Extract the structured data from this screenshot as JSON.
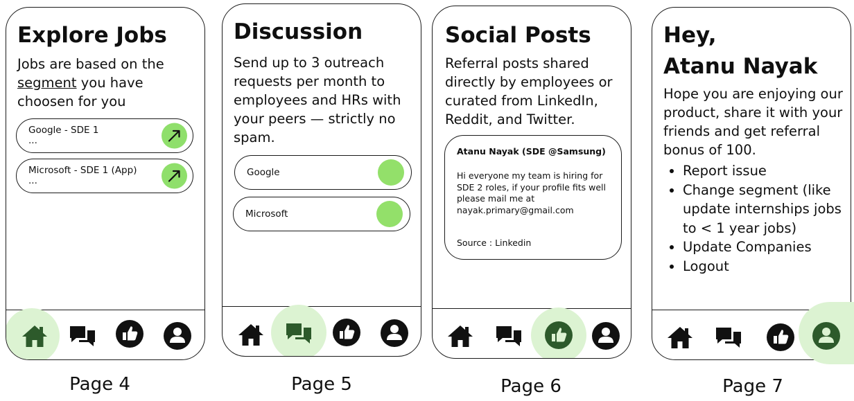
{
  "colors": {
    "accent_green": "#8fdf6b",
    "halo_green": "#dcf3d2",
    "ink": "#0f0f0f"
  },
  "icons": {
    "home": "home-icon",
    "discussion": "chat-bubbles-icon",
    "social": "thumbs-up-icon",
    "profile": "user-icon",
    "go": "arrow-up-right-icon"
  },
  "page4": {
    "title": "Explore Jobs",
    "desc_pre": "Jobs are based on the",
    "desc_link": "segment",
    "desc_post": "you have choosen for you",
    "jobs": [
      {
        "title": "Google - SDE 1",
        "sub": "..."
      },
      {
        "title": "Microsoft - SDE 1 (App)",
        "sub": "..."
      }
    ],
    "caption": "Page 4"
  },
  "page5": {
    "title": "Discussion",
    "desc": "Send up to 3 outreach requests per month to employees and HRs with your peers — strictly no spam.",
    "companies": [
      "Google",
      "Microsoft"
    ],
    "caption": "Page 5"
  },
  "page6": {
    "title": "Social Posts",
    "desc": "Referral posts shared directly by employees or curated from LinkedIn, Reddit, and Twitter.",
    "post": {
      "author": "Atanu Nayak (SDE @Samsung)",
      "body": "Hi everyone my team is hiring for SDE 2 roles, if your profile fits well please mail me at nayak.primary@gmail.com",
      "source": "Source : Linkedin"
    },
    "caption": "Page 6"
  },
  "page7": {
    "greeting": "Hey,",
    "name": "Atanu Nayak",
    "desc": "Hope you are enjoying our product, share it with your friends and get referral bonus of 100.",
    "menu": [
      "Report issue",
      "Change segment (like update internships jobs to < 1 year jobs)",
      "Update Companies",
      "Logout"
    ],
    "caption": "Page 7"
  }
}
